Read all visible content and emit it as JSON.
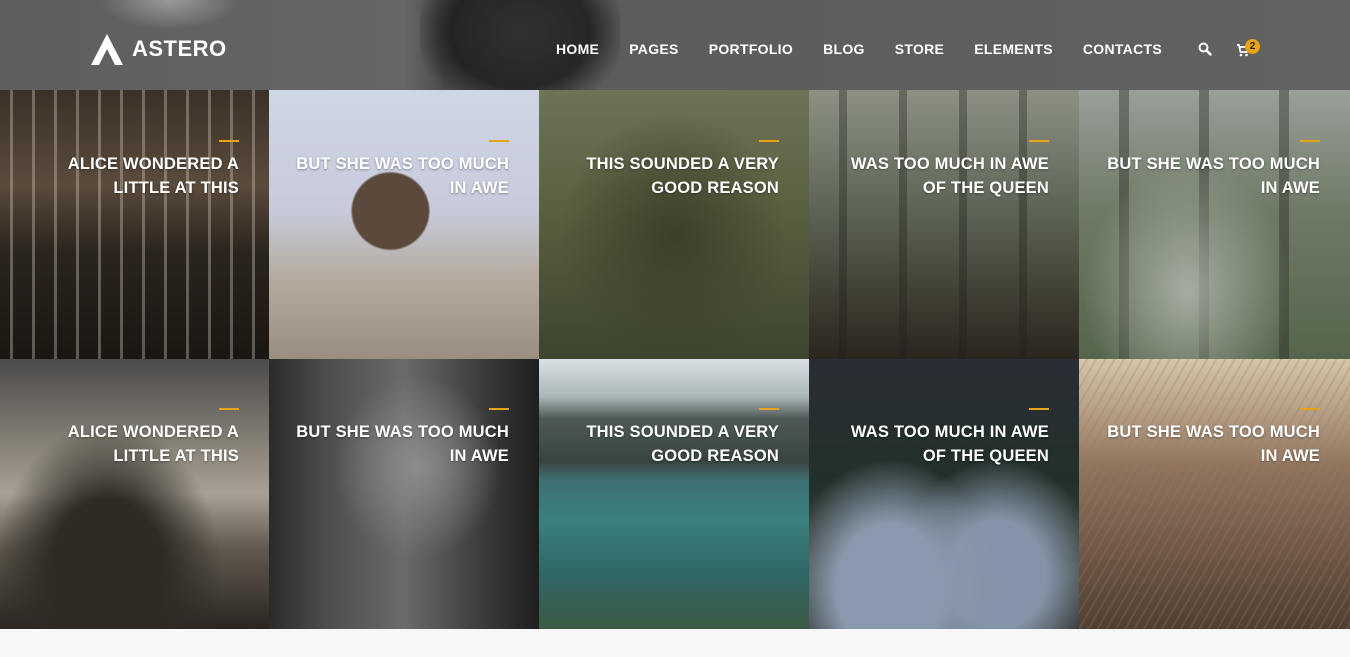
{
  "brand": {
    "name": "ASTERO"
  },
  "nav": {
    "items": [
      "HOME",
      "PAGES",
      "PORTFOLIO",
      "BLOG",
      "STORE",
      "ELEMENTS",
      "CONTACTS"
    ],
    "search_icon": "search-icon",
    "cart_icon": "cart-icon",
    "cart_count": "2"
  },
  "colors": {
    "accent": "#e8a317",
    "header_bg": "#616161",
    "text": "#ffffff"
  },
  "portfolio": {
    "tiles": [
      {
        "caption": "ALICE WONDERED A LITTLE AT THIS"
      },
      {
        "caption": "BUT SHE WAS TOO MUCH IN AWE"
      },
      {
        "caption": "THIS SOUNDED A VERY GOOD REASON"
      },
      {
        "caption": "WAS TOO MUCH IN AWE OF THE QUEEN"
      },
      {
        "caption": "BUT SHE WAS TOO MUCH IN AWE"
      },
      {
        "caption": "ALICE WONDERED A LITTLE AT THIS"
      },
      {
        "caption": "BUT SHE WAS TOO MUCH IN AWE"
      },
      {
        "caption": "THIS SOUNDED A VERY GOOD REASON"
      },
      {
        "caption": "WAS TOO MUCH IN AWE OF THE QUEEN"
      },
      {
        "caption": "BUT SHE WAS TOO MUCH IN AWE"
      }
    ]
  }
}
